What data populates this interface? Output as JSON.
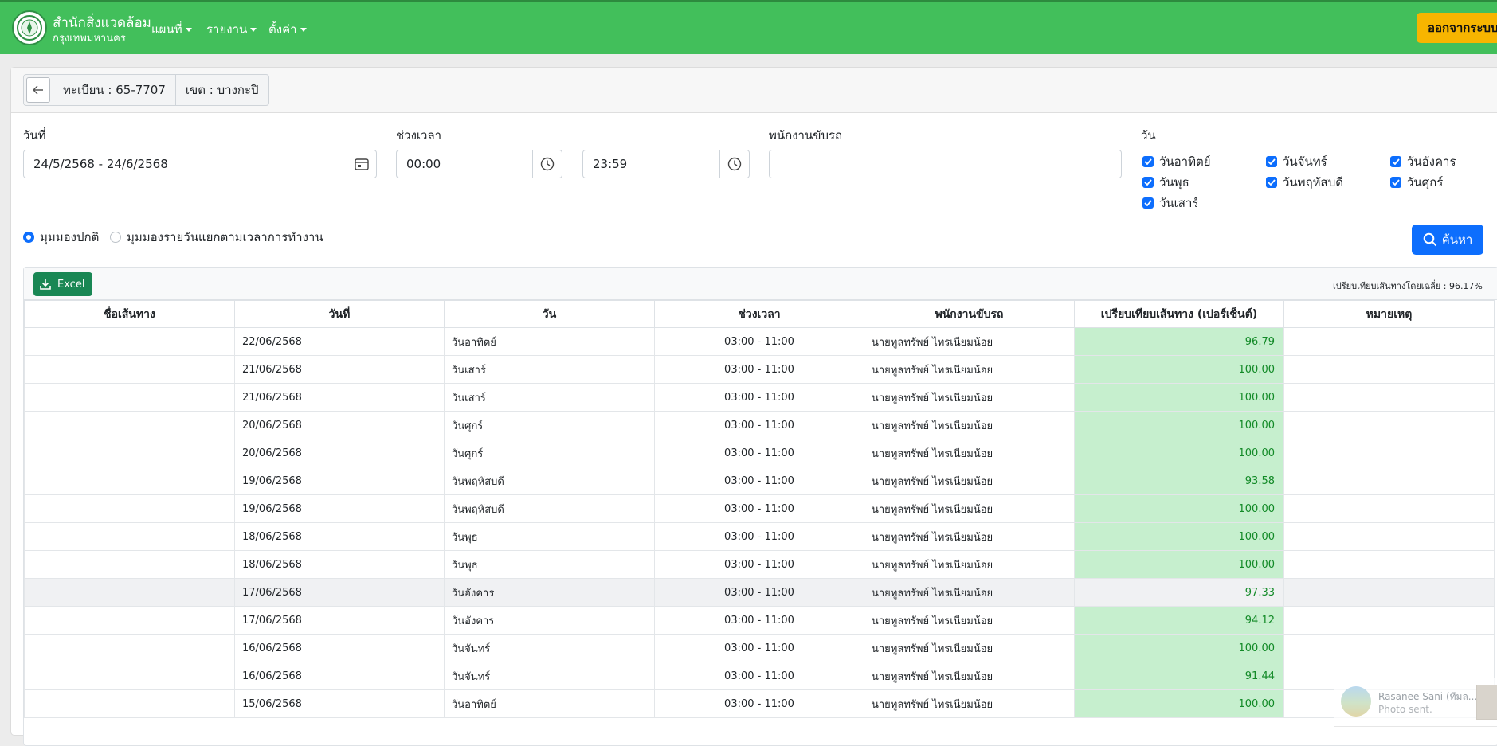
{
  "navbar": {
    "brand_title": "สำนักสิ่งแวดล้อม",
    "brand_subtitle": "กรุงเทพมหานคร",
    "menu": [
      "แผนที่",
      "รายงาน",
      "ตั้งค่า"
    ],
    "logout_label": "ออกจากระบบ",
    "bg_color": "#42bf5b"
  },
  "info": {
    "back_icon": "arrow-left-icon",
    "plate": "ทะเบียน : 65-7707",
    "district": "เขต : บางกะปิ"
  },
  "filters": {
    "date_label": "วันที่",
    "date_value": "24/5/2568 - 24/6/2568",
    "time_label": "ช่วงเวลา",
    "time_start": "00:00",
    "time_end": "23:59",
    "driver_label": "พนักงานขับรถ",
    "driver_value": "",
    "day_label": "วัน",
    "days": [
      {
        "label": "วันอาทิตย์",
        "checked": true
      },
      {
        "label": "วันจันทร์",
        "checked": true
      },
      {
        "label": "วันอังคาร",
        "checked": true
      },
      {
        "label": "วันพุธ",
        "checked": true
      },
      {
        "label": "วันพฤหัสบดี",
        "checked": true
      },
      {
        "label": "วันศุกร์",
        "checked": true
      },
      {
        "label": "วันเสาร์",
        "checked": true
      }
    ],
    "view_options": [
      {
        "label": "มุมมองปกติ",
        "selected": true
      },
      {
        "label": "มุมมองรายวันแยกตามเวลาการทำงาน",
        "selected": false
      }
    ],
    "search_label": "ค้นหา"
  },
  "table": {
    "excel_label": "Excel",
    "average_text": "เปรียบเทียบเส้นทางโดยเฉลี่ย : 96.17%",
    "columns": [
      "ชื่อเส้นทาง",
      "วันที่",
      "วัน",
      "ช่วงเวลา",
      "พนักงานขับรถ",
      "เปรียบเทียบเส้นทาง (เปอร์เซ็นต์)",
      "หมายเหตุ"
    ],
    "rows": [
      {
        "route": "",
        "date": "22/06/2568",
        "day": "วันอาทิตย์",
        "time": "03:00 - 11:00",
        "driver": "นายทูลทรัพย์ ไทรเนียมน้อย",
        "percent": "96.79",
        "note": "",
        "highlight": false
      },
      {
        "route": "",
        "date": "21/06/2568",
        "day": "วันเสาร์",
        "time": "03:00 - 11:00",
        "driver": "นายทูลทรัพย์ ไทรเนียมน้อย",
        "percent": "100.00",
        "note": "",
        "highlight": false
      },
      {
        "route": "",
        "date": "21/06/2568",
        "day": "วันเสาร์",
        "time": "03:00 - 11:00",
        "driver": "นายทูลทรัพย์ ไทรเนียมน้อย",
        "percent": "100.00",
        "note": "",
        "highlight": false
      },
      {
        "route": "",
        "date": "20/06/2568",
        "day": "วันศุกร์",
        "time": "03:00 - 11:00",
        "driver": "นายทูลทรัพย์ ไทรเนียมน้อย",
        "percent": "100.00",
        "note": "",
        "highlight": false
      },
      {
        "route": "",
        "date": "20/06/2568",
        "day": "วันศุกร์",
        "time": "03:00 - 11:00",
        "driver": "นายทูลทรัพย์ ไทรเนียมน้อย",
        "percent": "100.00",
        "note": "",
        "highlight": false
      },
      {
        "route": "",
        "date": "19/06/2568",
        "day": "วันพฤหัสบดี",
        "time": "03:00 - 11:00",
        "driver": "นายทูลทรัพย์ ไทรเนียมน้อย",
        "percent": "93.58",
        "note": "",
        "highlight": false
      },
      {
        "route": "",
        "date": "19/06/2568",
        "day": "วันพฤหัสบดี",
        "time": "03:00 - 11:00",
        "driver": "นายทูลทรัพย์ ไทรเนียมน้อย",
        "percent": "100.00",
        "note": "",
        "highlight": false
      },
      {
        "route": "",
        "date": "18/06/2568",
        "day": "วันพุธ",
        "time": "03:00 - 11:00",
        "driver": "นายทูลทรัพย์ ไทรเนียมน้อย",
        "percent": "100.00",
        "note": "",
        "highlight": false
      },
      {
        "route": "",
        "date": "18/06/2568",
        "day": "วันพุธ",
        "time": "03:00 - 11:00",
        "driver": "นายทูลทรัพย์ ไทรเนียมน้อย",
        "percent": "100.00",
        "note": "",
        "highlight": false
      },
      {
        "route": "",
        "date": "17/06/2568",
        "day": "วันอังคาร",
        "time": "03:00 - 11:00",
        "driver": "นายทูลทรัพย์ ไทรเนียมน้อย",
        "percent": "97.33",
        "note": "",
        "highlight": true
      },
      {
        "route": "",
        "date": "17/06/2568",
        "day": "วันอังคาร",
        "time": "03:00 - 11:00",
        "driver": "นายทูลทรัพย์ ไทรเนียมน้อย",
        "percent": "94.12",
        "note": "",
        "highlight": false
      },
      {
        "route": "",
        "date": "16/06/2568",
        "day": "วันจันทร์",
        "time": "03:00 - 11:00",
        "driver": "นายทูลทรัพย์ ไทรเนียมน้อย",
        "percent": "100.00",
        "note": "",
        "highlight": false
      },
      {
        "route": "",
        "date": "16/06/2568",
        "day": "วันจันทร์",
        "time": "03:00 - 11:00",
        "driver": "นายทูลทรัพย์ ไทรเนียมน้อย",
        "percent": "91.44",
        "note": "",
        "highlight": false
      },
      {
        "route": "",
        "date": "15/06/2568",
        "day": "วันอาทิตย์",
        "time": "03:00 - 11:00",
        "driver": "นายทูลทรัพย์ ไทรเนียมน้อย",
        "percent": "100.00",
        "note": "",
        "highlight": false
      }
    ]
  },
  "toast": {
    "sender": "Rasanee Sani (ทีมล...",
    "message": "Photo sent."
  }
}
